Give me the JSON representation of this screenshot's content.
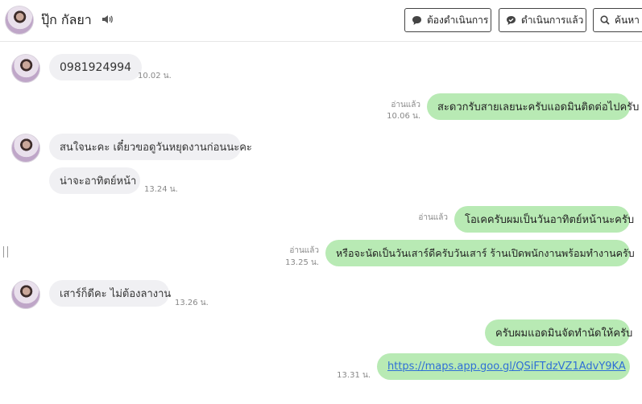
{
  "header": {
    "contact_name": "ปุ๊ก กัลยา",
    "buttons": {
      "todo": "ต้องดำเนินการ",
      "done": "ดำเนินการแล้ว",
      "search": "ค้นหา"
    }
  },
  "messages": [
    {
      "id": "m1",
      "direction": "in",
      "text": "0981924994",
      "time": "10.02 น."
    },
    {
      "id": "m2",
      "direction": "out",
      "text": "สะดวกรับสายเลยนะครับแอดมินติดต่อไปครับ",
      "read": "อ่านแล้ว",
      "time": "10.06 น."
    },
    {
      "id": "m3",
      "direction": "in",
      "text": "สนใจนะคะ เดี๋ยวขอดูวันหยุดงานก่อนนะคะ"
    },
    {
      "id": "m4",
      "direction": "in",
      "text": "น่าจะอาทิตย์หน้า",
      "time": "13.24 น."
    },
    {
      "id": "m5",
      "direction": "out",
      "text": "โอเคครับผมเป็นวันอาทิตย์หน้านะครับ",
      "read": "อ่านแล้ว"
    },
    {
      "id": "m6",
      "direction": "out",
      "text": "หรือจะนัดเป็นวันเสาร์ดีครับวันเสาร์ ร้านเปิดพนักงานพร้อมทำงานครับ",
      "read": "อ่านแล้ว",
      "time": "13.25 น."
    },
    {
      "id": "m7",
      "direction": "in",
      "text": "เสาร์ก็ดีคะ ไม่ต้องลางาน",
      "time": "13.26 น."
    },
    {
      "id": "m8",
      "direction": "out",
      "text": "ครับผมแอดมินจัดทำนัดให้ครับ"
    },
    {
      "id": "m9",
      "direction": "out",
      "text": "https://maps.app.goo.gl/QSiFTdzVZ1AdvY9KA",
      "time": "13.31 น.",
      "is_link": true
    }
  ],
  "colors": {
    "outgoing_bubble": "#b8eab4",
    "incoming_bubble": "#f0f0f3",
    "link": "#2f6fd6"
  },
  "icons": {
    "speaker": "speaker-icon",
    "todo": "speech-bubble-icon",
    "done": "check-bubble-icon",
    "search": "search-icon"
  }
}
